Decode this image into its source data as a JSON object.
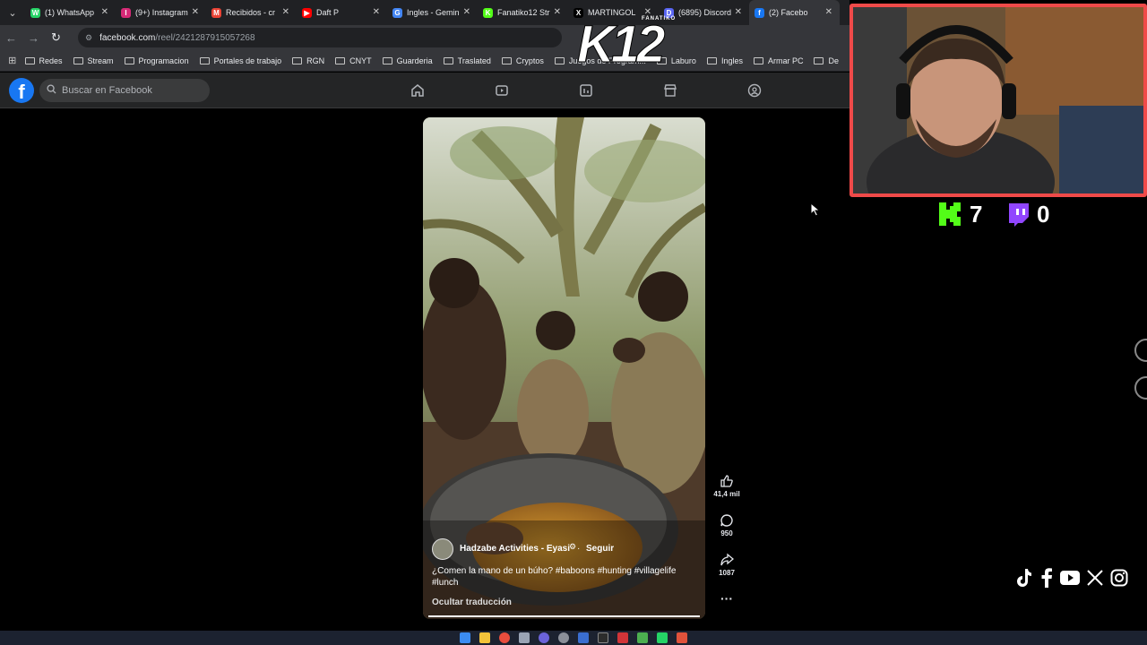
{
  "browser": {
    "tabs": [
      {
        "title": "(1) WhatsApp",
        "icon": "whatsapp-icon",
        "color": "#25d366",
        "glyph": "W"
      },
      {
        "title": "(9+) Instagram",
        "icon": "instagram-icon",
        "color": "#d62976",
        "glyph": "I"
      },
      {
        "title": "Recibidos - cr",
        "icon": "gmail-icon",
        "color": "#ea4335",
        "glyph": "M"
      },
      {
        "title": "Daft P",
        "icon": "youtube-icon",
        "color": "#ff0000",
        "glyph": "▶"
      },
      {
        "title": "Ingles - Gemin",
        "icon": "gemini-icon",
        "color": "#4285f4",
        "glyph": "G"
      },
      {
        "title": "Fanatiko12 Str",
        "icon": "kick-icon",
        "color": "#53fc18",
        "glyph": "K"
      },
      {
        "title": "MARTINGOL",
        "icon": "x-icon",
        "color": "#000000",
        "glyph": "X"
      },
      {
        "title": "(6895) Discord",
        "icon": "discord-icon",
        "color": "#5865f2",
        "glyph": "D"
      },
      {
        "title": "(2) Facebo",
        "icon": "facebook-icon",
        "color": "#1877f2",
        "glyph": "f",
        "active": true
      }
    ],
    "url_host": "facebook.com",
    "url_path": "/reel/2421287915057268",
    "bookmarks": [
      "Redes",
      "Stream",
      "Programacion",
      "Portales de trabajo",
      "RGN",
      "CNYT",
      "Guarderia",
      "Traslated",
      "Cryptos",
      "Juegos de Program...",
      "Laburo",
      "Ingles",
      "Armar PC",
      "De"
    ]
  },
  "facebook": {
    "search_placeholder": "Buscar en Facebook",
    "nav_icons": [
      "home-icon",
      "video-icon",
      "dashboard-icon",
      "marketplace-icon",
      "groups-icon"
    ]
  },
  "reel": {
    "author": "Hadzabe Activities - Eyasi",
    "follow": "Seguir",
    "caption_line1": "¿Comen la mano de un búho? #baboons #hunting #villagelife",
    "caption_line2": "#lunch",
    "translation_toggle": "Ocultar traducción",
    "likes": "41,4 mil",
    "comments": "950",
    "shares": "1087",
    "more": "···"
  },
  "overlay": {
    "logo_small": "FANATIKO",
    "logo_big": "K12",
    "kick_count": "7",
    "twitch_count": "0",
    "kick_color": "#53fc18",
    "twitch_color": "#9146ff",
    "webcam_border_color": "#ef4a49"
  }
}
